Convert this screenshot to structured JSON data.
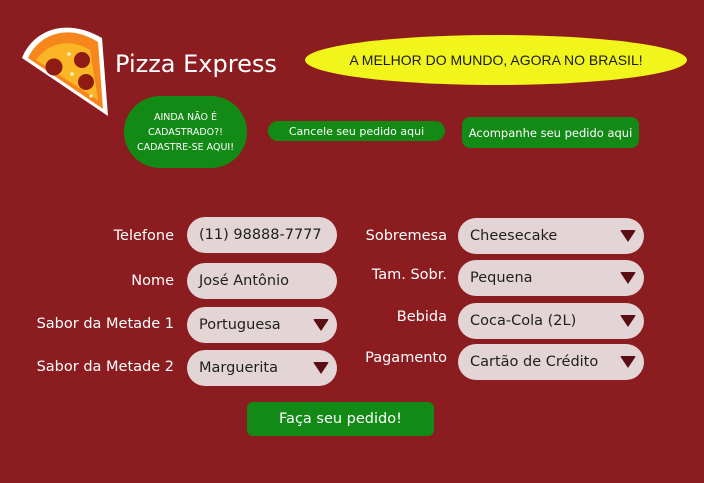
{
  "brand": {
    "name": "Pizza Express",
    "logo_icon": "pizza-slice-icon"
  },
  "slogan": "A MELHOR DO MUNDO, AGORA NO BRASIL!",
  "actions": {
    "register": "AINDA NÃO É CADASTRADO?! CADASTRE-SE AQUI!",
    "cancel": "Cancele seu pedido aqui",
    "track": "Acompanhe seu pedido aqui"
  },
  "form": {
    "telefone": {
      "label": "Telefone",
      "value": "(11) 98888-7777"
    },
    "nome": {
      "label": "Nome",
      "value": "José Antônio"
    },
    "sabor1": {
      "label": "Sabor da Metade 1",
      "value": "Portuguesa"
    },
    "sabor2": {
      "label": "Sabor da Metade 2",
      "value": "Marguerita"
    },
    "sobremesa": {
      "label": "Sobremesa",
      "value": "Cheesecake"
    },
    "tam_sobr": {
      "label": "Tam. Sobr.",
      "value": "Pequena"
    },
    "bebida": {
      "label": "Bebida",
      "value": "Coca-Cola (2L)"
    },
    "pagamento": {
      "label": "Pagamento",
      "value": "Cartão de Crédito"
    }
  },
  "submit": "Faça seu pedido!",
  "colors": {
    "background": "#8b1c1f",
    "accent_green": "#138a16",
    "slogan_yellow": "#f2f51c",
    "field_bg": "#e3d5d6",
    "caret": "#5a0d12"
  }
}
